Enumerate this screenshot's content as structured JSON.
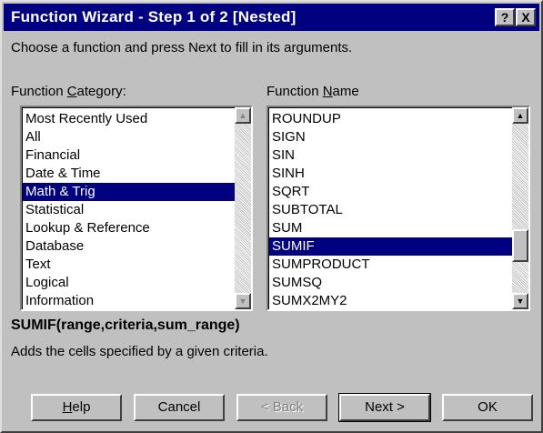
{
  "window": {
    "title": "Function Wizard - Step 1 of 2 [Nested]",
    "help_button": "?",
    "close_button": "X"
  },
  "instructions": "Choose a function and press Next to fill in its arguments.",
  "category": {
    "label_pre": "Function ",
    "label_accel": "C",
    "label_post": "ategory:",
    "items": [
      "Most Recently Used",
      "All",
      "Financial",
      "Date & Time",
      "Math & Trig",
      "Statistical",
      "Lookup & Reference",
      "Database",
      "Text",
      "Logical",
      "Information"
    ],
    "selected": "Math & Trig"
  },
  "function_name": {
    "label_pre": "Function ",
    "label_accel": "N",
    "label_post": "ame",
    "items": [
      "ROUNDUP",
      "SIGN",
      "SIN",
      "SINH",
      "SQRT",
      "SUBTOTAL",
      "SUM",
      "SUMIF",
      "SUMPRODUCT",
      "SUMSQ",
      "SUMX2MY2"
    ],
    "selected": "SUMIF"
  },
  "syntax": "SUMIF(range,criteria,sum_range)",
  "description": "Adds the cells specified by a given criteria.",
  "buttons": {
    "help_accel": "H",
    "help_rest": "elp",
    "cancel": "Cancel",
    "back": "< Back",
    "next": "Next >",
    "ok": "OK"
  }
}
